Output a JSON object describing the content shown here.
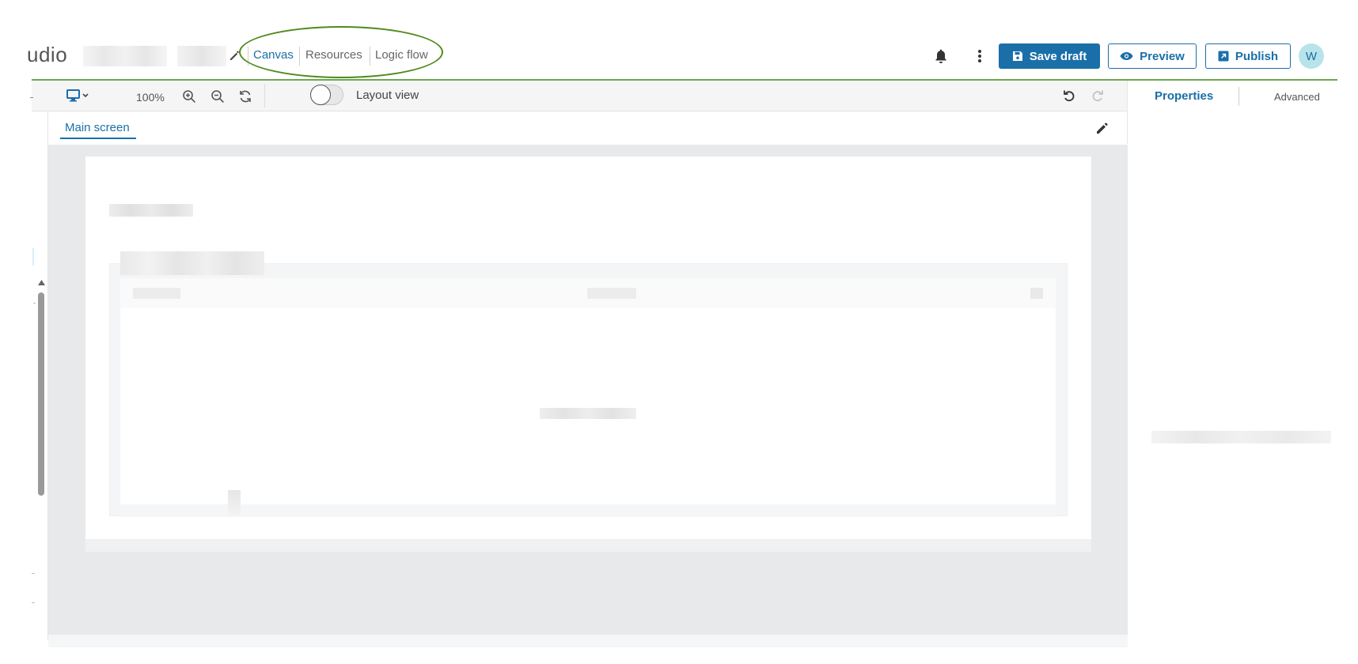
{
  "header": {
    "app_title": "udio",
    "nav_tabs": [
      {
        "label": "Canvas",
        "active": true
      },
      {
        "label": "Resources",
        "active": false
      },
      {
        "label": "Logic flow",
        "active": false
      }
    ],
    "buttons": {
      "save_draft": "Save draft",
      "preview": "Preview",
      "publish": "Publish"
    },
    "avatar_initial": "W",
    "icons": [
      "edit-pencil-icon",
      "bell-icon",
      "kebab-menu-icon",
      "save-icon",
      "eye-icon",
      "external-link-icon"
    ]
  },
  "toolbar": {
    "zoom_level": "100%",
    "layout_view_label": "Layout view",
    "layout_view_enabled": false,
    "icons": [
      "desktop-icon",
      "chevron-down-icon",
      "zoom-in-icon",
      "zoom-out-icon",
      "refresh-icon",
      "undo-icon",
      "redo-icon"
    ]
  },
  "screen": {
    "tab_label": "Main screen"
  },
  "right_panel": {
    "tabs": [
      {
        "label": "Properties",
        "active": true
      },
      {
        "label": "Advanced",
        "active": false
      }
    ]
  },
  "colors": {
    "accent": "#1a6fa8",
    "highlight_ellipse": "#4e8b1c",
    "header_line": "#6aa84f",
    "avatar_bg": "#b8e3ea",
    "canvas_bg": "#e8e9eb"
  }
}
